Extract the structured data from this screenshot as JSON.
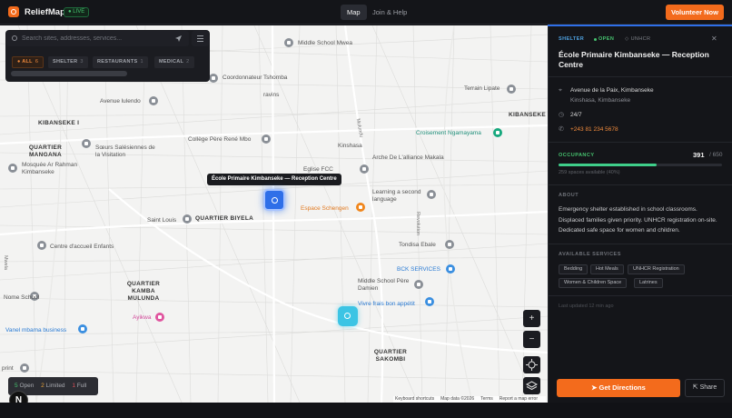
{
  "header": {
    "brand": "ReliefMap",
    "live_badge": "● LIVE",
    "nav": [
      {
        "label": "Map",
        "active": true
      },
      {
        "label": "Join & Help",
        "active": false
      }
    ],
    "cta": "Volunteer Now",
    "accent_color": "#f36b1c"
  },
  "search": {
    "placeholder": "Search sites, addresses, services...",
    "filters": [
      {
        "label": "● ALL",
        "count": "6",
        "active": true
      },
      {
        "label": "SHELTER",
        "count": "3",
        "active": false
      },
      {
        "label": "RESTAURANTS",
        "count": "1",
        "active": false
      },
      {
        "label": "MEDICAL",
        "count": "2",
        "active": false
      }
    ]
  },
  "map": {
    "tooltip": "École Primaire Kimbanseke — Reception Centre",
    "places": [
      {
        "name": "Middle School Mwea",
        "kind": "school"
      },
      {
        "name": "Coordonnateur Tshomba",
        "kind": "poi"
      },
      {
        "name": "Terrain Lipate",
        "kind": "poi"
      },
      {
        "name": "Avenue lulendo",
        "kind": "poi"
      },
      {
        "name": "ravins",
        "kind": "poi"
      },
      {
        "name": "Sœurs Salésiennes de la Visitation",
        "kind": "church"
      },
      {
        "name": "Collège Père René Mbo",
        "kind": "school"
      },
      {
        "name": "Kinshasa",
        "kind": "poi"
      },
      {
        "name": "Croisement Ngamayama",
        "kind": "green"
      },
      {
        "name": "Mosquée Ar Rahman Kimbanseke",
        "kind": "poi"
      },
      {
        "name": "Eglise FCC",
        "kind": "church"
      },
      {
        "name": "Arche De L'alliance Makala",
        "kind": "church"
      },
      {
        "name": "Learning a second language",
        "kind": "school"
      },
      {
        "name": "Espace Schengen",
        "kind": "orange"
      },
      {
        "name": "Saint Louis",
        "kind": "church"
      },
      {
        "name": "Centre d'accueil Enfants",
        "kind": "poi"
      },
      {
        "name": "Tondisa Ebale",
        "kind": "poi"
      },
      {
        "name": "BCK SERVICES",
        "kind": "blue"
      },
      {
        "name": "Middle School Père Damien",
        "kind": "school"
      },
      {
        "name": "Nome School",
        "kind": "school"
      },
      {
        "name": "Ayikwa",
        "kind": "pink"
      },
      {
        "name": "Vivre frais bon appétit",
        "kind": "blue"
      },
      {
        "name": "Vanel mbama business",
        "kind": "blue"
      },
      {
        "name": "print",
        "kind": "poi"
      }
    ],
    "districts": [
      "KIBANSEKE I",
      "KIBANSEKE II",
      "QUARTIER MANGANA",
      "QUARTIER BIYELA",
      "QUARTIER KAMBA MULUNDA",
      "QUARTIER SAKOMBI"
    ],
    "streets": [
      "Mulundu",
      "Revolution",
      "Mwela"
    ],
    "controls": {
      "zoom_in": "+",
      "zoom_out": "−"
    },
    "legend": {
      "open": "5",
      "open_label": "Open",
      "limited": "2",
      "limited_label": "Limited",
      "full": "1",
      "full_label": "Full"
    },
    "attribution": [
      "Keyboard shortcuts",
      "Map data ©2026",
      "Terms",
      "Report a map error"
    ],
    "badge": "N"
  },
  "panel": {
    "category": "SHELTER",
    "status": "OPEN",
    "partner": "UNHCR",
    "title": "École Primaire Kimbanseke — Reception Centre",
    "address_line1": "Avenue de la Paix, Kimbanseke",
    "address_line2": "Kinshasa, Kimbanseke",
    "hours": "24/7",
    "phone": "+243 81 234 5678",
    "occupancy": {
      "label": "OCCUPANCY",
      "current": "391",
      "capacity": "/ 650",
      "fraction": 0.6,
      "sub": "259 spaces available (40%)"
    },
    "about_label": "ABOUT",
    "about": "Emergency shelter established in school classrooms. Displaced families given priority. UNHCR registration on-site. Dedicated safe space for women and children.",
    "services_label": "AVAILABLE SERVICES",
    "services": [
      "Bedding",
      "Hot Meals",
      "UNHCR Registration",
      "Women & Children Space",
      "Latrines"
    ],
    "updated": "Last updated 12 min ago",
    "directions": "Get Directions",
    "share": "Share"
  }
}
